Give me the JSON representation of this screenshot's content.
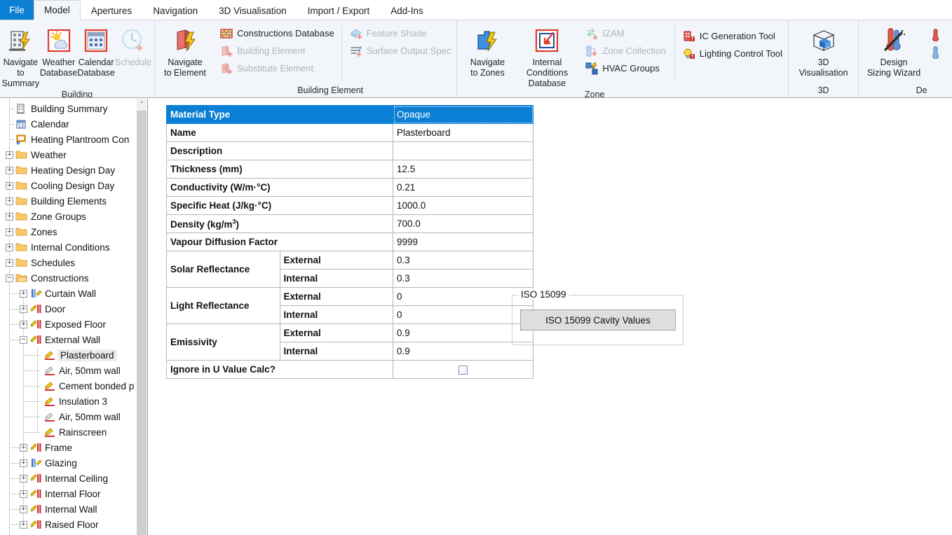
{
  "tabs": {
    "file_label": "File",
    "items": [
      {
        "label": "Model",
        "active": true
      },
      {
        "label": "Apertures",
        "active": false
      },
      {
        "label": "Navigation",
        "active": false
      },
      {
        "label": "3D Visualisation",
        "active": false
      },
      {
        "label": "Import / Export",
        "active": false
      },
      {
        "label": "Add-Ins",
        "active": false
      }
    ]
  },
  "ribbon": {
    "groups": [
      {
        "title": "Building",
        "big_buttons": [
          {
            "label": "Navigate to\nSummary",
            "icon": "building-lightning-icon",
            "disabled": false
          },
          {
            "label": "Weather\nDatabase",
            "icon": "weather-sun-cloud-icon",
            "disabled": false
          },
          {
            "label": "Calendar\nDatabase",
            "icon": "calendar-icon",
            "disabled": false
          },
          {
            "label": "Schedule",
            "icon": "clock-add-icon",
            "disabled": true
          }
        ]
      },
      {
        "title": "Building Element",
        "big_buttons": [
          {
            "label": "Navigate\nto Element",
            "icon": "wall-lightning-icon",
            "disabled": false
          }
        ],
        "small_col_1": [
          {
            "label": "Constructions Database",
            "icon": "brick-wall-icon",
            "disabled": false
          },
          {
            "label": "Building Element",
            "icon": "building-element-add-icon",
            "disabled": true
          },
          {
            "label": "Substitute Element",
            "icon": "substitute-element-icon",
            "disabled": true
          }
        ],
        "small_col_2": [
          {
            "label": "Feature Shade",
            "icon": "feature-shade-icon",
            "disabled": true
          },
          {
            "label": "Surface Output Spec",
            "icon": "surface-output-spec-icon",
            "disabled": true
          }
        ]
      },
      {
        "title": "Zone",
        "big_buttons": [
          {
            "label": "Navigate\nto Zones",
            "icon": "zone-lightning-icon",
            "disabled": false
          },
          {
            "label": "Internal Conditions\nDatabase",
            "icon": "internal-conditions-icon",
            "disabled": false
          }
        ],
        "small_col_1": [
          {
            "label": "IZAM",
            "icon": "izam-icon",
            "disabled": true
          },
          {
            "label": "Zone Collection",
            "icon": "zone-collection-icon",
            "disabled": true
          },
          {
            "label": "HVAC Groups",
            "icon": "hvac-groups-icon",
            "disabled": false
          }
        ],
        "small_col_2": [
          {
            "label": "IC Generation Tool",
            "icon": "ic-generation-icon",
            "disabled": false
          },
          {
            "label": "Lighting Control Tool",
            "icon": "lightbulb-icon",
            "disabled": false
          }
        ]
      },
      {
        "title": "3D",
        "big_buttons": [
          {
            "label": "3D\nVisualisation",
            "icon": "cube-3d-icon",
            "disabled": false
          }
        ]
      },
      {
        "title": "De",
        "big_buttons": [
          {
            "label": "Design\nSizing Wizard",
            "icon": "design-sizing-wizard-icon",
            "disabled": false
          }
        ],
        "small_col_1": [
          {
            "label": "",
            "icon": "thermometer-red-icon",
            "disabled": false
          },
          {
            "label": "",
            "icon": "thermometer-blue-icon",
            "disabled": false
          }
        ]
      }
    ]
  },
  "tree": {
    "scrollbar_up_glyph": "˄",
    "items": [
      {
        "label": "Building Summary",
        "depth": 0,
        "icon": "building-icon",
        "expander": "none",
        "selected": false
      },
      {
        "label": "Calendar",
        "depth": 0,
        "icon": "calendar-12-icon",
        "expander": "none",
        "selected": false
      },
      {
        "label": "Heating Plantroom Con",
        "depth": 0,
        "icon": "plantroom-icon",
        "expander": "none",
        "selected": false
      },
      {
        "label": "Weather",
        "depth": 0,
        "icon": "folder-icon",
        "expander": "plus",
        "selected": false
      },
      {
        "label": "Heating Design Day",
        "depth": 0,
        "icon": "folder-icon",
        "expander": "plus",
        "selected": false
      },
      {
        "label": "Cooling Design Day",
        "depth": 0,
        "icon": "folder-icon",
        "expander": "plus",
        "selected": false
      },
      {
        "label": "Building Elements",
        "depth": 0,
        "icon": "folder-icon",
        "expander": "plus",
        "selected": false
      },
      {
        "label": "Zone Groups",
        "depth": 0,
        "icon": "folder-icon",
        "expander": "plus",
        "selected": false
      },
      {
        "label": "Zones",
        "depth": 0,
        "icon": "folder-icon",
        "expander": "plus",
        "selected": false
      },
      {
        "label": "Internal Conditions",
        "depth": 0,
        "icon": "folder-icon",
        "expander": "plus",
        "selected": false
      },
      {
        "label": "Schedules",
        "depth": 0,
        "icon": "folder-icon",
        "expander": "plus",
        "selected": false
      },
      {
        "label": "Constructions",
        "depth": 0,
        "icon": "folder-open-icon",
        "expander": "minus",
        "selected": false
      },
      {
        "label": "Curtain Wall",
        "depth": 1,
        "icon": "curtain-wall-icon",
        "expander": "plus",
        "selected": false
      },
      {
        "label": "Door",
        "depth": 1,
        "icon": "construction-icon",
        "expander": "plus",
        "selected": false
      },
      {
        "label": "Exposed Floor",
        "depth": 1,
        "icon": "construction-icon",
        "expander": "plus",
        "selected": false
      },
      {
        "label": "External Wall",
        "depth": 1,
        "icon": "construction-icon",
        "expander": "minus",
        "selected": false
      },
      {
        "label": "Plasterboard",
        "depth": 2,
        "icon": "material-opaque-icon",
        "expander": "none",
        "selected": true
      },
      {
        "label": "Air, 50mm wall",
        "depth": 2,
        "icon": "material-air-icon",
        "expander": "none",
        "selected": false
      },
      {
        "label": "Cement bonded p",
        "depth": 2,
        "icon": "material-opaque-icon",
        "expander": "none",
        "selected": false
      },
      {
        "label": "Insulation 3",
        "depth": 2,
        "icon": "material-opaque-icon",
        "expander": "none",
        "selected": false
      },
      {
        "label": "Air, 50mm wall",
        "depth": 2,
        "icon": "material-air-icon",
        "expander": "none",
        "selected": false
      },
      {
        "label": "Rainscreen",
        "depth": 2,
        "icon": "material-opaque-icon",
        "expander": "none",
        "selected": false
      },
      {
        "label": "Frame",
        "depth": 1,
        "icon": "construction-icon",
        "expander": "plus",
        "selected": false
      },
      {
        "label": "Glazing",
        "depth": 1,
        "icon": "curtain-wall-icon",
        "expander": "plus",
        "selected": false
      },
      {
        "label": "Internal Ceiling",
        "depth": 1,
        "icon": "construction-icon",
        "expander": "plus",
        "selected": false
      },
      {
        "label": "Internal Floor",
        "depth": 1,
        "icon": "construction-icon",
        "expander": "plus",
        "selected": false
      },
      {
        "label": "Internal Wall",
        "depth": 1,
        "icon": "construction-icon",
        "expander": "plus",
        "selected": false
      },
      {
        "label": "Raised Floor",
        "depth": 1,
        "icon": "construction-icon",
        "expander": "plus",
        "selected": false
      }
    ]
  },
  "properties": {
    "rows": [
      {
        "label": "Material Type",
        "value": "Opaque",
        "header": true,
        "sub": null,
        "type": "text"
      },
      {
        "label": "Name",
        "value": "Plasterboard",
        "header": false,
        "sub": null,
        "type": "text"
      },
      {
        "label": "Description",
        "value": "",
        "header": false,
        "sub": null,
        "type": "text"
      },
      {
        "label": "Thickness (mm)",
        "value": "12.5",
        "header": false,
        "sub": null,
        "type": "text"
      },
      {
        "label": "Conductivity (W/m·°C)",
        "value": "0.21",
        "header": false,
        "sub": null,
        "type": "text"
      },
      {
        "label": "Specific Heat (J/kg·°C)",
        "value": "1000.0",
        "header": false,
        "sub": null,
        "type": "text"
      },
      {
        "label": "Density (kg/m3)",
        "value": "700.0",
        "header": false,
        "sub": null,
        "type": "superscript3"
      },
      {
        "label": "Vapour Diffusion Factor",
        "value": "9999",
        "header": false,
        "sub": null,
        "type": "text"
      },
      {
        "label": "Solar Reflectance",
        "value": "0.3",
        "header": false,
        "sub": "External",
        "type": "text",
        "rowspan": 2
      },
      {
        "label": "",
        "value": "0.3",
        "header": false,
        "sub": "Internal",
        "type": "text",
        "continued": true
      },
      {
        "label": "Light Reflectance",
        "value": "0",
        "header": false,
        "sub": "External",
        "type": "text",
        "rowspan": 2
      },
      {
        "label": "",
        "value": "0",
        "header": false,
        "sub": "Internal",
        "type": "text",
        "continued": true
      },
      {
        "label": "Emissivity",
        "value": "0.9",
        "header": false,
        "sub": "External",
        "type": "text",
        "rowspan": 2
      },
      {
        "label": "",
        "value": "0.9",
        "header": false,
        "sub": "Internal",
        "type": "text",
        "continued": true
      },
      {
        "label": "Ignore in U Value Calc?",
        "value": "",
        "header": false,
        "sub": null,
        "type": "checkbox",
        "checked": false
      }
    ]
  },
  "iso_group": {
    "title": "ISO 15099",
    "button_label": "ISO 15099 Cavity Values"
  },
  "colors": {
    "accent_blue": "#0a7fd4",
    "ribbon_bg": "#f2f6fb",
    "disabled_text": "#adb5bd",
    "selection_gray": "#ececec"
  }
}
